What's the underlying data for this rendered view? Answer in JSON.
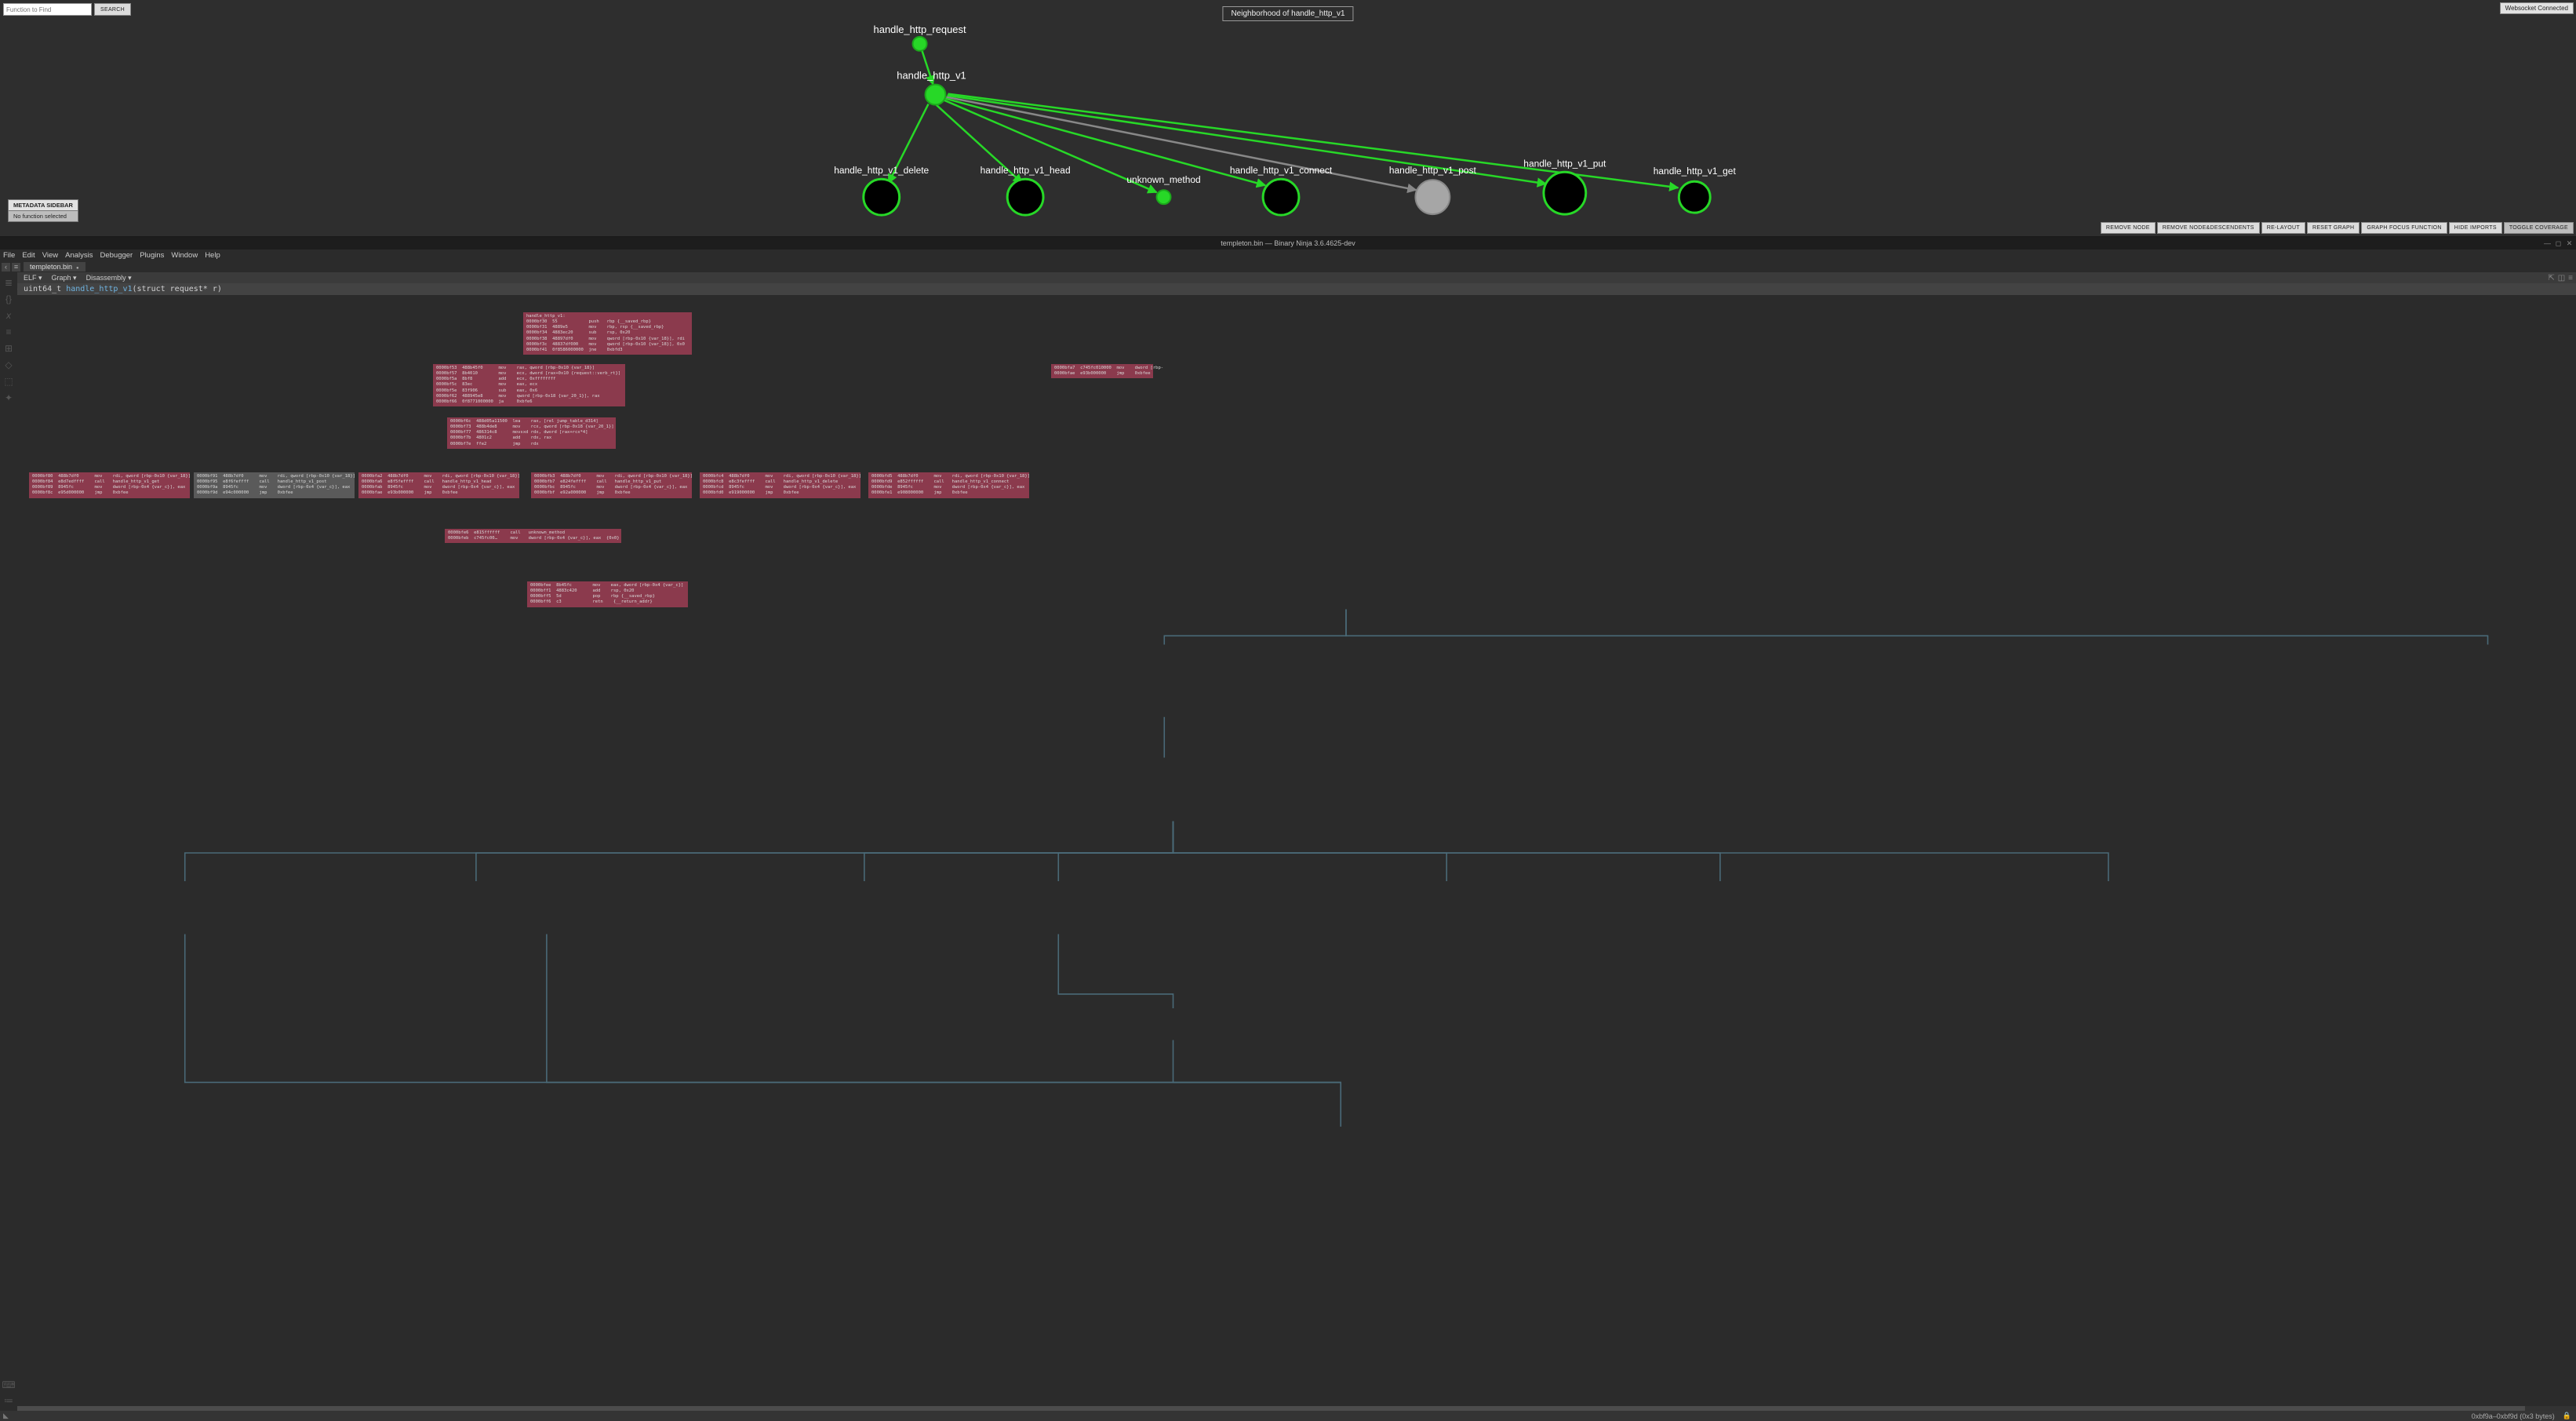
{
  "top": {
    "search_placeholder": "Function to Find",
    "search_btn": "SEARCH",
    "title": "Neighborhood of handle_http_v1",
    "ws_status": "Websocket Connected",
    "meta_header": "METADATA SIDEBAR",
    "meta_body": "No function selected",
    "buttons": {
      "remove_node": "REMOVE NODE",
      "remove_desc": "REMOVE NODE&DESCENDENTS",
      "relayout": "RE-LAYOUT",
      "reset": "RESET GRAPH",
      "focus": "GRAPH FOCUS FUNCTION",
      "hide_imports": "HIDE IMPORTS",
      "toggle_cov": "TOGGLE COVERAGE"
    },
    "nodes": {
      "handle_http_request": "handle_http_request",
      "handle_http_v1": "handle_http_v1",
      "handle_http_v1_delete": "handle_http_v1_delete",
      "handle_http_v1_head": "handle_http_v1_head",
      "unknown_method": "unknown_method",
      "handle_http_v1_connect": "handle_http_v1_connect",
      "handle_http_v1_post": "handle_http_v1_post",
      "handle_http_v1_put": "handle_http_v1_put",
      "handle_http_v1_get": "handle_http_v1_get"
    }
  },
  "bn": {
    "title": "templeton.bin — Binary Ninja 3.6.4625-dev",
    "menu": [
      "File",
      "Edit",
      "View",
      "Analysis",
      "Debugger",
      "Plugins",
      "Window",
      "Help"
    ],
    "tab": "templeton.bin",
    "view_selectors": [
      "ELF ▾",
      "Graph ▾",
      "Disassembly ▾"
    ],
    "func_sig_ret": "uint64_t",
    "func_sig_name": "handle_http_v1",
    "func_sig_args": "(struct request* r)",
    "status_sel": "0xbf9a–0xbf9d (0x3 bytes)",
    "blocks": {
      "b0": "handle_http_v1:\n0000bf30  55            push   rbp {__saved_rbp}\n0000bf31  4889e5        mov    rbp, rsp {__saved_rbp}\n0000bf34  4883ec20      sub    rsp, 0x20\n0000bf38  48897df0      mov    qword [rbp-0x10 {var_18}], rdi\n0000bf3c  48837df000    mov    qword [rbp-0x10 {var_18}], 0x0\n0000bf41  0f8586000000  jne    0xbfd3",
      "b1": "0000bf53  488b45f0      mov    rax, qword [rbp-0x10 {var_18}]\n0000bf57  8b4010        mov    ecx, dword [rax+0x10 {request::verb_rt}]\n0000bf5a  8bf8          add    ecx, 0xffffffff\n0000bf5c  83ec          mov    eax, ecx\n0000bf5e  83f906        sub    eax, 0x6\n0000bf62  488945e8      mov    qword [rbp-0x18 {var_20_1}], rax\n0000bf66  0f8771000000  ja     0xbfe6",
      "b2": "0000bf6c  488d05a11500  lea    rax, [rel jump_table_d314]\n0000bf73  488b4de8      mov    rcx, qword [rbp-0x18 {var_20_1}]\n0000bf77  486314c8      movsxd rdx, dword [rax+rcx*4]\n0000bf7b  4801c2        add    rdx, rax\n0000bf7e  ffe2          jmp    rdx",
      "b3": "0000bf80  488b7df0      mov    rdi, qword [rbp-0x10 {var_18}]\n0000bf84  e8d7edffff    call   handle_http_v1_get\n0000bf89  8945fc        mov    dword [rbp-0x4 {var_c}], eax\n0000bf8c  e95d000000    jmp    0xbfee",
      "b4": "0000bf91  488b7df0      mov    rdi, qword [rbp-0x10 {var_18}]\n0000bf95  e8f6feffff    call   handle_http_v1_post\n0000bf9a  8945fc        mov    dword [rbp-0x4 {var_c}], eax\n0000bf9d  e94c000000    jmp    0xbfee",
      "b5": "0000bfa2  488b7df0      mov    rdi, qword [rbp-0x10 {var_18}]\n0000bfa6  e8f5feffff    call   handle_http_v1_head\n0000bfab  8945fc        mov    dword [rbp-0x4 {var_c}], eax\n0000bfae  e93b000000    jmp    0xbfee",
      "b6": "0000bfb3  488b7df0      mov    rdi, qword [rbp-0x10 {var_18}]\n0000bfb7  e824feffff    call   handle_http_v1_put\n0000bfbc  8945fc        mov    dword [rbp-0x4 {var_c}], eax\n0000bfbf  e92a000000    jmp    0xbfee",
      "b7": "0000bfc4  488b7df0      mov    rdi, qword [rbp-0x10 {var_18}]\n0000bfc8  e8c3feffff    call   handle_http_v1_delete\n0000bfcd  8945fc        mov    dword [rbp-0x4 {var_c}], eax\n0000bfd0  e919000000    jmp    0xbfee",
      "b8": "0000bfd5  488b7df0      mov    rdi, qword [rbp-0x10 {var_18}]\n0000bfd9  e852ffffff    call   handle_http_v1_connect\n0000bfde  8945fc        mov    dword [rbp-0x4 {var_c}], eax\n0000bfe1  e908000000    jmp    0xbfee",
      "b9": "0000bfe6  e815ffffff    call   unknown_method\n0000bfeb  c745fc00…     mov    dword [rbp-0x4 {var_c}], eax  {0x0}",
      "b10": "0000bfee  8b45fc        mov    eax, dword [rbp-0x4 {var_c}]\n0000bff1  4883c420      add    rsp, 0x20\n0000bff5  5d            pop    rbp {__saved_rbp}\n0000bff6  c3            retn    {__return_addr}",
      "b11": "0000bfa7  c745fc010000  mov    dword [rbp-\n0000bfae  e93b000000    jmp    0xbfee"
    }
  }
}
